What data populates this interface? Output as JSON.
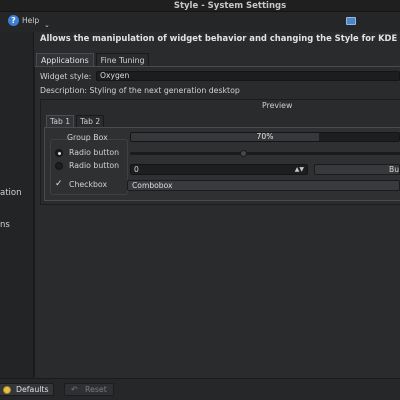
{
  "window": {
    "title": "Style - System Settings"
  },
  "toolbar": {
    "help_label": "Help"
  },
  "sidebar": {
    "fragments": [
      "ation",
      "ns"
    ]
  },
  "header": {
    "text": "Allows the manipulation of widget behavior and changing the Style for KDE"
  },
  "tabs": [
    {
      "label": "Applications",
      "active": true
    },
    {
      "label": "Fine Tuning",
      "active": false
    }
  ],
  "widget_style": {
    "label": "Widget style:",
    "value": "Oxygen"
  },
  "description": "Description: Styling of the next generation desktop",
  "preview": {
    "title": "Preview",
    "tabs": [
      {
        "label": "Tab 1",
        "active": true
      },
      {
        "label": "Tab 2",
        "active": false
      }
    ],
    "group_box_title": "Group Box",
    "radio1": {
      "label": "Radio button",
      "checked": true
    },
    "radio2": {
      "label": "Radio button",
      "checked": false
    },
    "checkbox": {
      "label": "Checkbox",
      "checked": true
    },
    "progress": {
      "value": 0.7,
      "text": "70%"
    },
    "slider": {
      "value": 0.42
    },
    "spinbox": {
      "value": "0"
    },
    "button_label": "Bu",
    "combobox": {
      "value": "Combobox"
    }
  },
  "buttons": {
    "defaults": "Defaults",
    "reset": "Reset"
  },
  "colors": {
    "accent": "#3d7fd4",
    "background": "#2a2b2d"
  }
}
